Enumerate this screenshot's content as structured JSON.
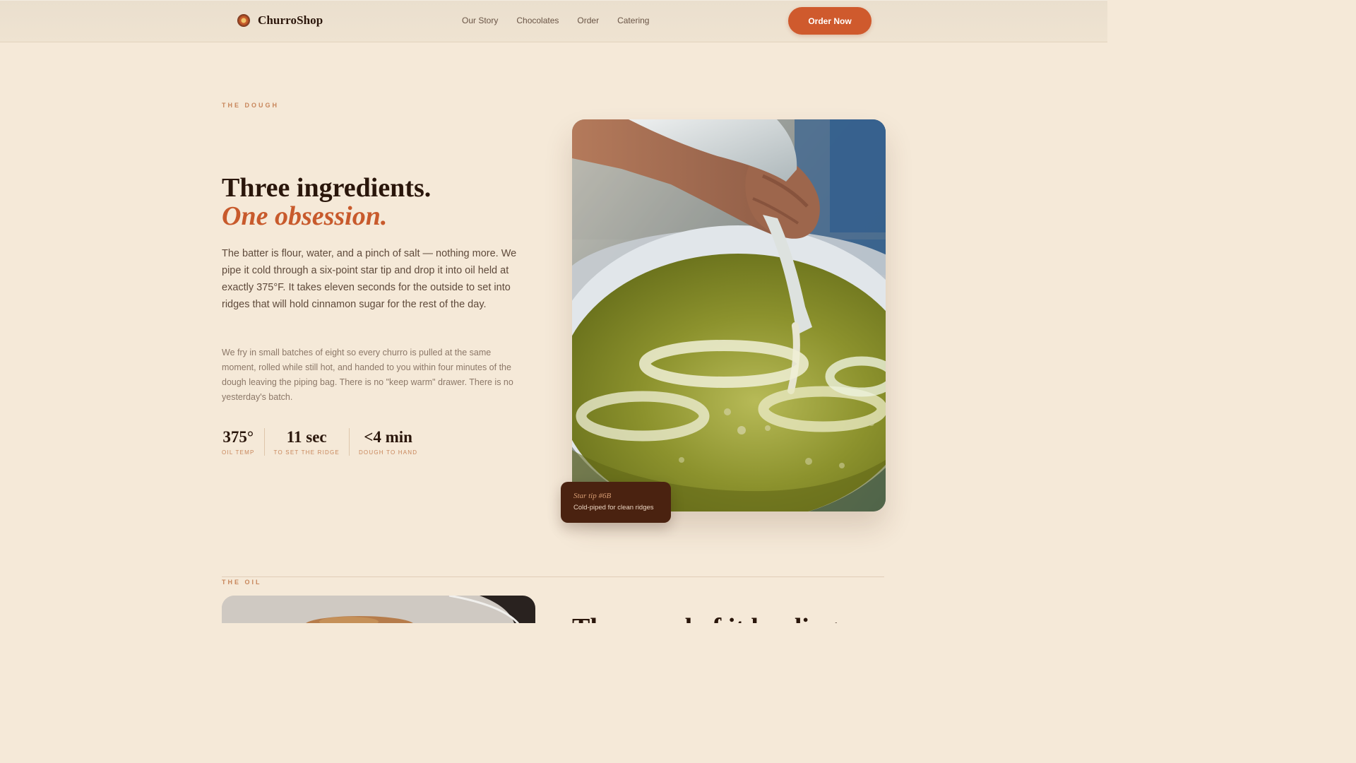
{
  "header": {
    "brand_name": "ChurroShop",
    "brand_icon": "churro-coil-icon",
    "nav_items": [
      {
        "label": "Our Story"
      },
      {
        "label": "Chocolates"
      },
      {
        "label": "Order"
      },
      {
        "label": "Catering"
      }
    ],
    "cta_label": "Order Now"
  },
  "dough_section": {
    "eyebrow": "THE DOUGH",
    "headline_line1": "Three ingredients.",
    "headline_line2": "One obsession.",
    "lead": "The batter is flour, water, and a pinch of salt — nothing more. We pipe it cold through a six-point star tip and drop it into oil held at exactly 375°F. It takes eleven seconds for the outside to set into ridges that will hold cinnamon sugar for the rest of the day.",
    "body": "We fry in small batches of eight so every churro is pulled at the same moment, rolled while still hot, and handed to you within four minutes of the dough leaving the piping bag. There is no \"keep warm\" drawer. There is no yesterday's batch.",
    "stats": [
      {
        "value": "375°",
        "label": "OIL TEMP"
      },
      {
        "value": "11 sec",
        "label": "TO SET THE RIDGE"
      },
      {
        "value": "<4 min",
        "label": "DOUGH TO HAND"
      }
    ],
    "photo_caption": {
      "title": "Star tip #6B",
      "text": "Cold-piped for clean ridges"
    }
  },
  "oil_section": {
    "eyebrow": "THE OIL",
    "headline_partial": "The sound of it landing"
  },
  "colors": {
    "background": "#f5e9d8",
    "accent": "#cf5a2d",
    "headline_accent": "#c85a2c",
    "eyebrow": "#c8865b",
    "caption_card": "#4a2210"
  }
}
